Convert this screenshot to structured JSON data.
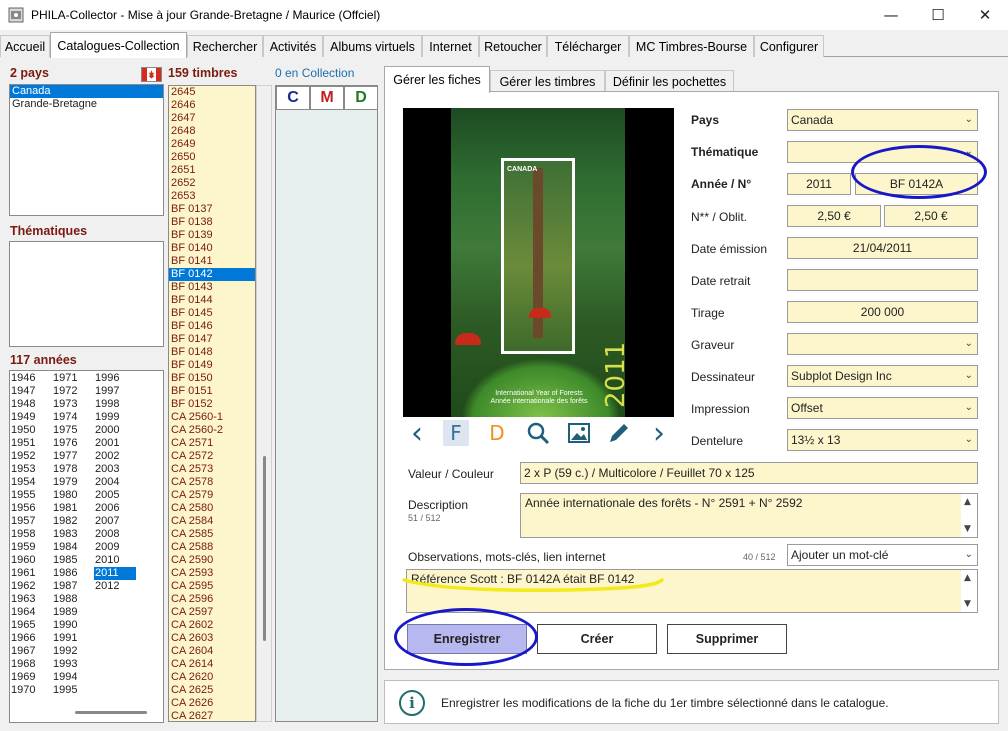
{
  "window": {
    "title": "PHILA-Collector - Mise à jour Grande-Bretagne / Maurice (Offciel)",
    "minimize_label": "—",
    "maximize_label": "☐",
    "close_label": "✕"
  },
  "main_tabs": [
    {
      "label": "Accueil"
    },
    {
      "label": "Catalogues-Collection"
    },
    {
      "label": "Rechercher"
    },
    {
      "label": "Activités"
    },
    {
      "label": "Albums virtuels"
    },
    {
      "label": "Internet"
    },
    {
      "label": "Retoucher"
    },
    {
      "label": "Télécharger"
    },
    {
      "label": "MC Timbres-Bourse"
    },
    {
      "label": "Configurer"
    }
  ],
  "left": {
    "countries_header": "2 pays",
    "countries": [
      "Canada",
      "Grande-Bretagne"
    ],
    "thematiques_header": "Thématiques",
    "years_header": "117 années",
    "years_col1": [
      "1946",
      "1947",
      "1948",
      "1949",
      "1950",
      "1951",
      "1952",
      "1953",
      "1954",
      "1955",
      "1956",
      "1957",
      "1958",
      "1959",
      "1960",
      "1961",
      "1962",
      "1963",
      "1964",
      "1965",
      "1966",
      "1967",
      "1968",
      "1969",
      "1970"
    ],
    "years_col2": [
      "1971",
      "1972",
      "1973",
      "1974",
      "1975",
      "1976",
      "1977",
      "1978",
      "1979",
      "1980",
      "1981",
      "1982",
      "1983",
      "1984",
      "1985",
      "1986",
      "1987",
      "1988",
      "1989",
      "1990",
      "1991",
      "1992",
      "1993",
      "1994",
      "1995"
    ],
    "years_col3": [
      "1996",
      "1997",
      "1998",
      "1999",
      "2000",
      "2001",
      "2002",
      "2003",
      "2004",
      "2005",
      "2006",
      "2007",
      "2008",
      "2009",
      "2010",
      "2011",
      "2012"
    ],
    "selected_year": "2011",
    "stamps_header": "159 timbres",
    "stamps": [
      "2645",
      "2646",
      "2647",
      "2648",
      "2649",
      "2650",
      "2651",
      "2652",
      "2653",
      "BF 0137",
      "BF 0138",
      "BF 0139",
      "BF 0140",
      "BF 0141",
      "BF 0142",
      "BF 0143",
      "BF 0144",
      "BF 0145",
      "BF 0146",
      "BF 0147",
      "BF 0148",
      "BF 0149",
      "BF 0150",
      "BF 0151",
      "BF 0152",
      "CA 2560-1",
      "CA 2560-2",
      "CA 2571",
      "CA 2572",
      "CA 2573",
      "CA 2578",
      "CA 2579",
      "CA 2580",
      "CA 2584",
      "CA 2585",
      "CA 2588",
      "CA 2590",
      "CA 2593",
      "CA 2595",
      "CA 2596",
      "CA 2597",
      "CA 2602",
      "CA 2603",
      "CA 2604",
      "CA 2614",
      "CA 2620",
      "CA 2625",
      "CA 2626",
      "CA 2627"
    ],
    "selected_stamp": "BF 0142",
    "collection_header": "0 en Collection",
    "c_label": "C",
    "m_label": "M",
    "d_label": "D"
  },
  "sub_tabs": [
    {
      "label": "Gérer les fiches"
    },
    {
      "label": "Gérer les timbres"
    },
    {
      "label": "Définir les pochettes"
    }
  ],
  "image_text": {
    "canada_top": "CANADA",
    "caption_en": "International Year of Forests",
    "caption_fr": "Année internationale des forêts",
    "year": "2011"
  },
  "nav": {
    "prev": "‹",
    "f": "F",
    "d": "D",
    "search": "⌕",
    "image": "▣",
    "edit": "✎",
    "next": "›"
  },
  "form": {
    "pays_label": "Pays",
    "pays_value": "Canada",
    "thematique_label": "Thématique",
    "thematique_value": "",
    "annee_label": "Année / N°",
    "annee_value": "2011",
    "numero_value": "BF 0142A",
    "neuf_label": "N** / Oblit.",
    "neuf_value": "2,50 €",
    "oblit_value": "2,50 €",
    "date_emission_label": "Date émission",
    "date_emission_value": "21/04/2011",
    "date_retrait_label": "Date retrait",
    "date_retrait_value": "",
    "tirage_label": "Tirage",
    "tirage_value": "200 000",
    "graveur_label": "Graveur",
    "graveur_value": "",
    "dessinateur_label": "Dessinateur",
    "dessinateur_value": "Subplot Design Inc",
    "impression_label": "Impression",
    "impression_value": "Offset",
    "dentelure_label": "Dentelure",
    "dentelure_value": "13½ x 13",
    "valeur_label": "Valeur / Couleur",
    "valeur_value": "2 x P (59 c.) / Multicolore / Feuillet 70 x 125",
    "description_label": "Description",
    "description_count": "51 / 512",
    "description_value": "Année internationale des forêts - N° 2591 + N° 2592",
    "observations_label": "Observations, mots-clés, lien internet",
    "observations_count": "40 / 512",
    "keyword_value": "Ajouter un mot-clé",
    "observations_value": "Référence Scott : BF 0142A était BF 0142"
  },
  "buttons": {
    "save": "Enregistrer",
    "create": "Créer",
    "delete": "Supprimer"
  },
  "status": {
    "icon": "i",
    "text": "Enregistrer les modifications de la fiche du 1er timbre sélectionné dans le catalogue."
  },
  "colors": {
    "accent_selection": "#0078d7",
    "field_background": "#fdf6cc",
    "header_text": "#7a1a10",
    "annotation_blue": "#1818c8",
    "annotation_yellow": "#f2ea1a"
  }
}
